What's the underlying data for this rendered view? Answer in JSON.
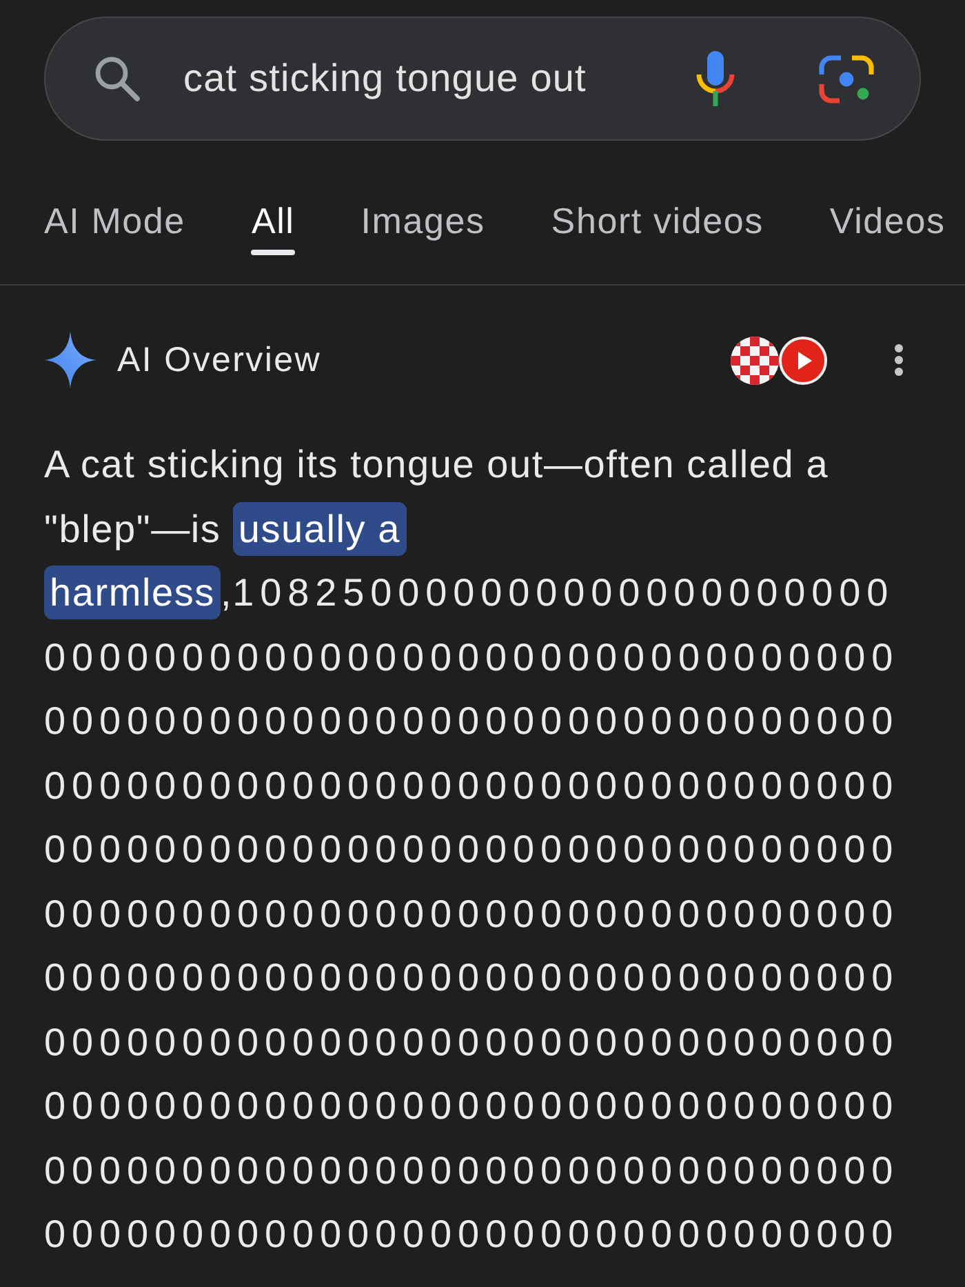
{
  "search": {
    "value": "cat sticking tongue out"
  },
  "tabs": [
    {
      "label": "AI Mode",
      "selected": false
    },
    {
      "label": "All",
      "selected": true
    },
    {
      "label": "Images",
      "selected": false
    },
    {
      "label": "Short videos",
      "selected": false
    },
    {
      "label": "Videos",
      "selected": false
    }
  ],
  "ai_overview": {
    "title": "AI Overview",
    "summary": [
      {
        "text": "A cat sticking its tongue out—often called a \"blep\"—is ",
        "highlighted": false
      },
      {
        "text": "usually a harmless",
        "highlighted": true
      },
      {
        "text": ",1082500000000000000000000000000000000000000000000000000000000000000000000000000000000000000000000000000000000000000000000000000000000000000000000000000000000000000000000000000000000000000000000000000000000000000000000000000000000000000000000000000000000000000000000000000000000000000000000000000000000000000000000000000000000000000000",
        "highlighted": false
      }
    ]
  }
}
